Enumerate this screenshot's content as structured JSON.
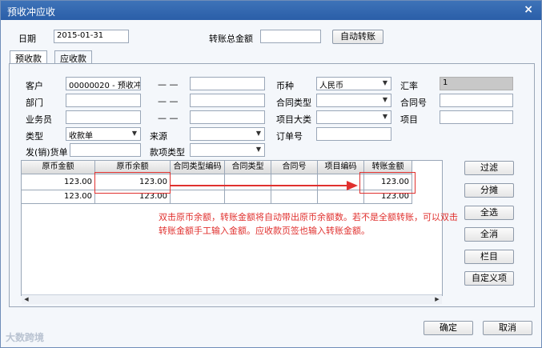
{
  "window": {
    "title": "预收冲应收",
    "close_icon": "×"
  },
  "header": {
    "date_label": "日期",
    "date_value": "2015-01-31",
    "transfer_total_label": "转账总金额",
    "transfer_total_value": "",
    "auto_transfer_button": "自动转账"
  },
  "tabs": [
    {
      "label": "预收款"
    },
    {
      "label": "应收款"
    }
  ],
  "form": {
    "customer_label": "客户",
    "customer_value": "00000020 - 预收冲",
    "dept_label": "部门",
    "dept_value": "",
    "salesman_label": "业务员",
    "salesman_value": "",
    "type_label": "类型",
    "type_value": "收款单",
    "voucher_no_label": "发(销)货单",
    "voucher_no_value": "",
    "dash1": "— —",
    "dash2": "— —",
    "dash3": "— —",
    "range1_to": "",
    "range2_to": "",
    "range3_to": "",
    "source_label": "来源",
    "source_value": "",
    "fund_type_label": "款项类型",
    "fund_type_value": "",
    "currency_label": "币种",
    "currency_value": "人民币",
    "contract_type_label": "合同类型",
    "contract_type_value": "",
    "project_class_label": "项目大类",
    "project_class_value": "",
    "order_no_label": "订单号",
    "order_no_value": "",
    "rate_label": "汇率",
    "rate_value": "1",
    "contract_no_label": "合同号",
    "contract_no_value": "",
    "project_label": "项目",
    "project_value": ""
  },
  "grid": {
    "columns": [
      "原币金额",
      "原币余额",
      "合同类型编码",
      "合同类型",
      "合同号",
      "项目编码",
      "转账金额"
    ],
    "rows": [
      [
        "123.00",
        "123.00",
        "",
        "",
        "",
        "",
        "123.00"
      ],
      [
        "123.00",
        "123.00",
        "",
        "",
        "",
        "",
        "123.00"
      ]
    ]
  },
  "side_buttons": {
    "filter": "过滤",
    "distribute": "分摊",
    "select_all": "全选",
    "clear_all": "全消",
    "columns": "栏目",
    "custom_item": "自定义项"
  },
  "annotation": {
    "line1": "双击原币余额，转账金额将自动带出原币余额数。若不是全额转账，可以双击",
    "line2": "转账金额手工输入金额。应收款页签也输入转账金额。"
  },
  "footer": {
    "ok_button": "确定",
    "cancel_button": "取消"
  },
  "watermark": "大数跨境",
  "colors": {
    "title_bar": "#2f63ab",
    "annotation_red": "#e0302e"
  }
}
